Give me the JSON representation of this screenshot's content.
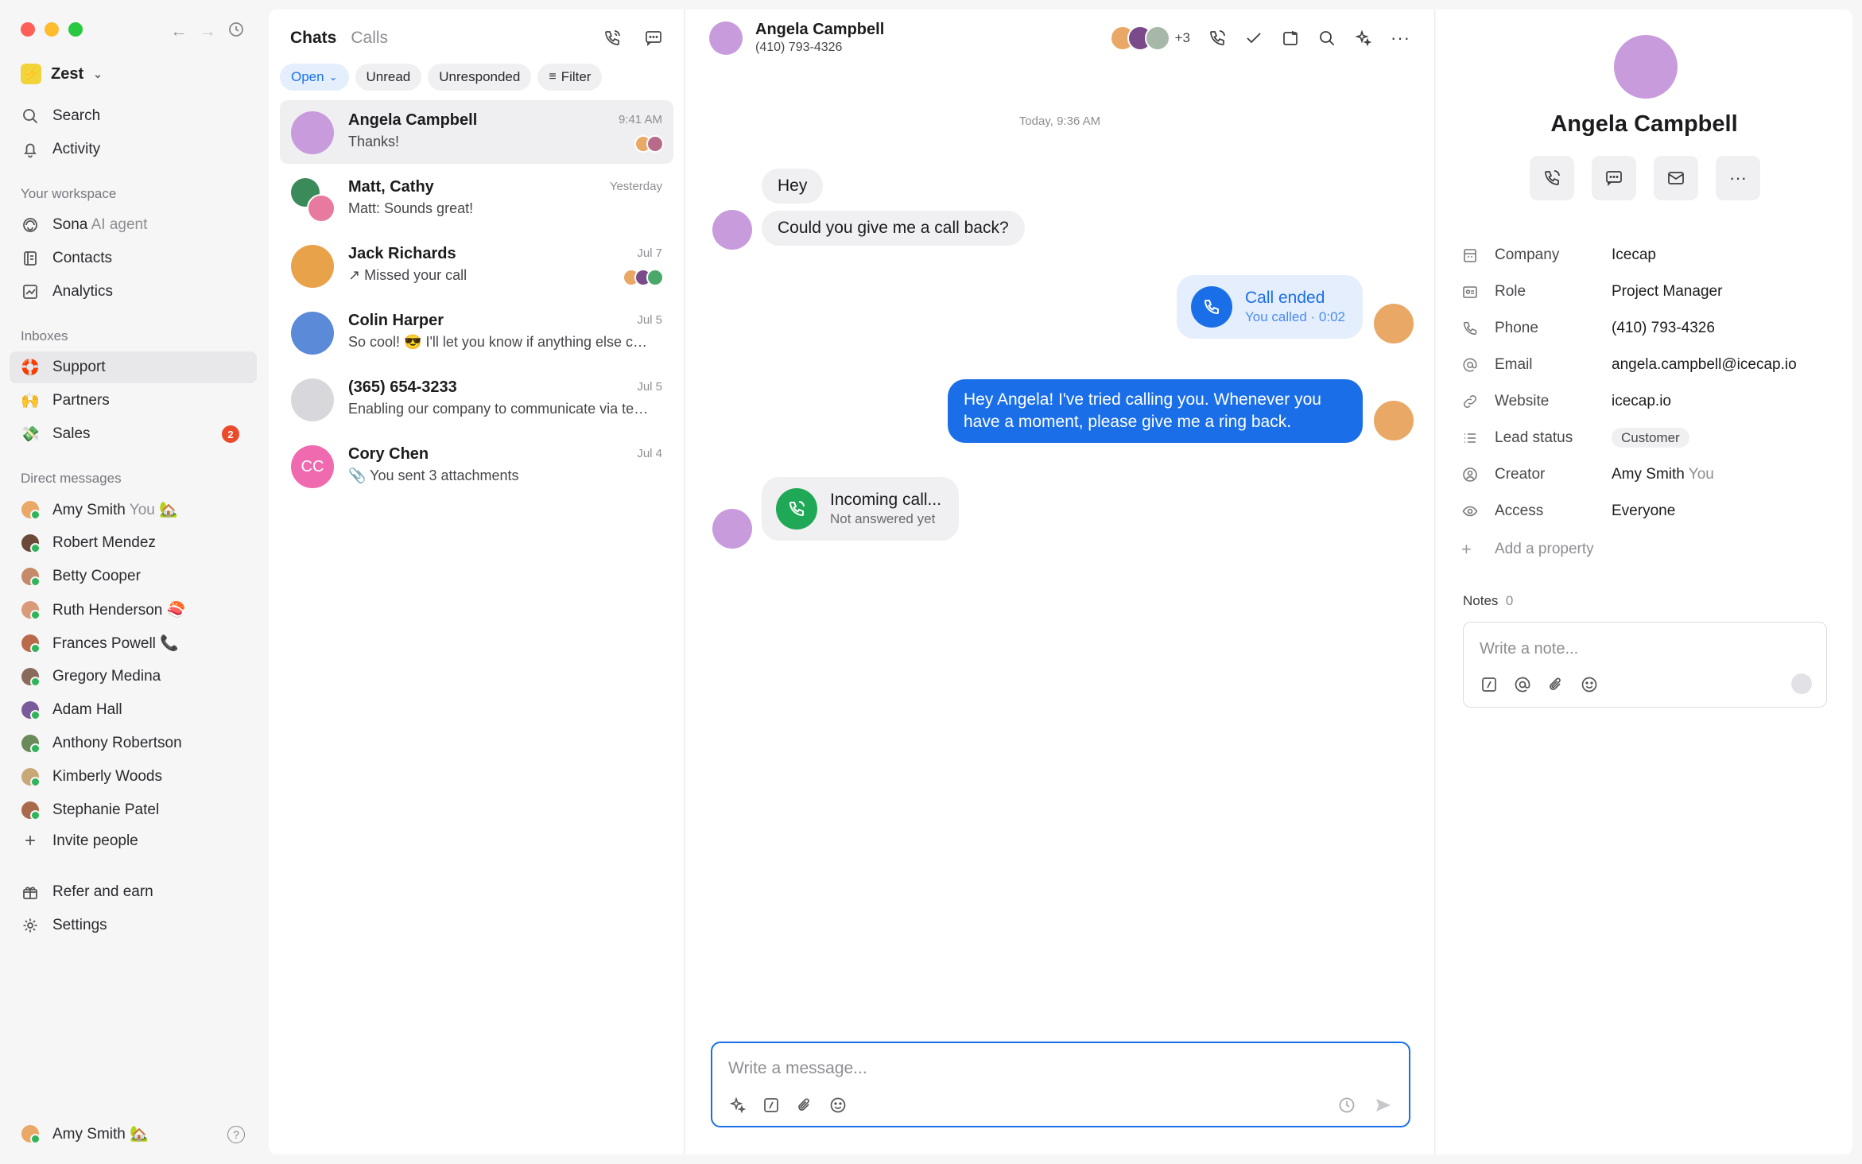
{
  "sidebar": {
    "workspace": "Zest",
    "nav": [
      {
        "label": "Search",
        "icon": "search-icon"
      },
      {
        "label": "Activity",
        "icon": "bell-icon"
      }
    ],
    "your_workspace_heading": "Your workspace",
    "workspace_items": [
      {
        "label": "Sona",
        "suffix": "AI agent",
        "icon": "sona-icon"
      },
      {
        "label": "Contacts",
        "icon": "contacts-icon"
      },
      {
        "label": "Analytics",
        "icon": "analytics-icon"
      }
    ],
    "inboxes_heading": "Inboxes",
    "inboxes": [
      {
        "label": "Support",
        "emoji": "🛟",
        "active": true
      },
      {
        "label": "Partners",
        "emoji": "🙌"
      },
      {
        "label": "Sales",
        "emoji": "💸",
        "badge": "2"
      }
    ],
    "dm_heading": "Direct messages",
    "dms": [
      {
        "label": "Amy Smith",
        "suffix": "You",
        "emoji": "🏡",
        "color": "#e9a866"
      },
      {
        "label": "Robert Mendez",
        "color": "#6b4a3a"
      },
      {
        "label": "Betty Cooper",
        "color": "#c48a6a"
      },
      {
        "label": "Ruth Henderson",
        "emoji": "🍣",
        "color": "#d99a7a"
      },
      {
        "label": "Frances Powell",
        "emoji": "📞",
        "color": "#b86a4a"
      },
      {
        "label": "Gregory Medina",
        "color": "#8a6a5a"
      },
      {
        "label": "Adam Hall",
        "color": "#7a5a9a"
      },
      {
        "label": "Anthony Robertson",
        "color": "#6a8a5a"
      },
      {
        "label": "Kimberly Woods",
        "color": "#c9a878"
      },
      {
        "label": "Stephanie Patel",
        "color": "#a86a4a"
      }
    ],
    "invite": "Invite people",
    "refer": "Refer and earn",
    "settings": "Settings",
    "footer_user": "Amy Smith",
    "footer_emoji": "🏡"
  },
  "list": {
    "tab_chats": "Chats",
    "tab_calls": "Calls",
    "filters": [
      "Open",
      "Unread",
      "Unresponded",
      "Filter"
    ],
    "conversations": [
      {
        "name": "Angela Campbell",
        "preview": "Thanks!",
        "time": "9:41 AM",
        "color": "#c89bdc"
      },
      {
        "name": "Matt, Cathy",
        "preview": "Matt: Sounds great!",
        "time": "Yesterday",
        "color": "#3a8a5a"
      },
      {
        "name": "Jack Richards",
        "preview": "Missed your call",
        "time": "Jul 7",
        "color": "#e8a24a"
      },
      {
        "name": "Colin Harper",
        "preview": "So cool! 😎 I'll let you know if anything else comes up",
        "time": "Jul 5",
        "color": "#5a8ad8"
      },
      {
        "name": "(365) 654-3233",
        "preview": "Enabling our company to communicate via text messages",
        "time": "Jul 5",
        "color": "#d8d8dc"
      },
      {
        "name": "Cory Chen",
        "preview": "You sent 3 attachments",
        "time": "Jul 4",
        "color": "#f06ab0",
        "initials": "CC"
      }
    ]
  },
  "chat": {
    "contact_name": "Angela Campbell",
    "contact_phone": "(410) 793-4326",
    "participants_more": "+3",
    "day_stamp": "Today, 9:36 AM",
    "messages": {
      "in1": "Hey",
      "in2": "Could you give me a call back?",
      "call_ended_title": "Call ended",
      "call_ended_sub": "You called · 0:02",
      "out1": "Hey Angela! I've tried calling you. Whenever you have a moment, please give me a ring back.",
      "incoming_title": "Incoming call...",
      "incoming_sub": "Not answered yet"
    },
    "composer_placeholder": "Write a message..."
  },
  "detail": {
    "name": "Angela Campbell",
    "properties": [
      {
        "key": "Company",
        "value": "Icecap",
        "icon": "building-icon"
      },
      {
        "key": "Role",
        "value": "Project Manager",
        "icon": "id-card-icon"
      },
      {
        "key": "Phone",
        "value": "(410) 793-4326",
        "icon": "phone-icon"
      },
      {
        "key": "Email",
        "value": "angela.campbell@icecap.io",
        "icon": "at-icon"
      },
      {
        "key": "Website",
        "value": "icecap.io",
        "icon": "link-icon"
      },
      {
        "key": "Lead status",
        "value": "Customer",
        "icon": "list-icon"
      },
      {
        "key": "Creator",
        "value": "Amy Smith",
        "suffix": "You",
        "icon": "user-circle-icon"
      },
      {
        "key": "Access",
        "value": "Everyone",
        "icon": "eye-icon"
      }
    ],
    "add_property": "Add a property",
    "notes_label": "Notes",
    "notes_count": "0",
    "note_placeholder": "Write a note..."
  },
  "colors": {
    "accent": "#1a6fe8",
    "green": "#1fa855",
    "badge": "#ea4b2b"
  }
}
